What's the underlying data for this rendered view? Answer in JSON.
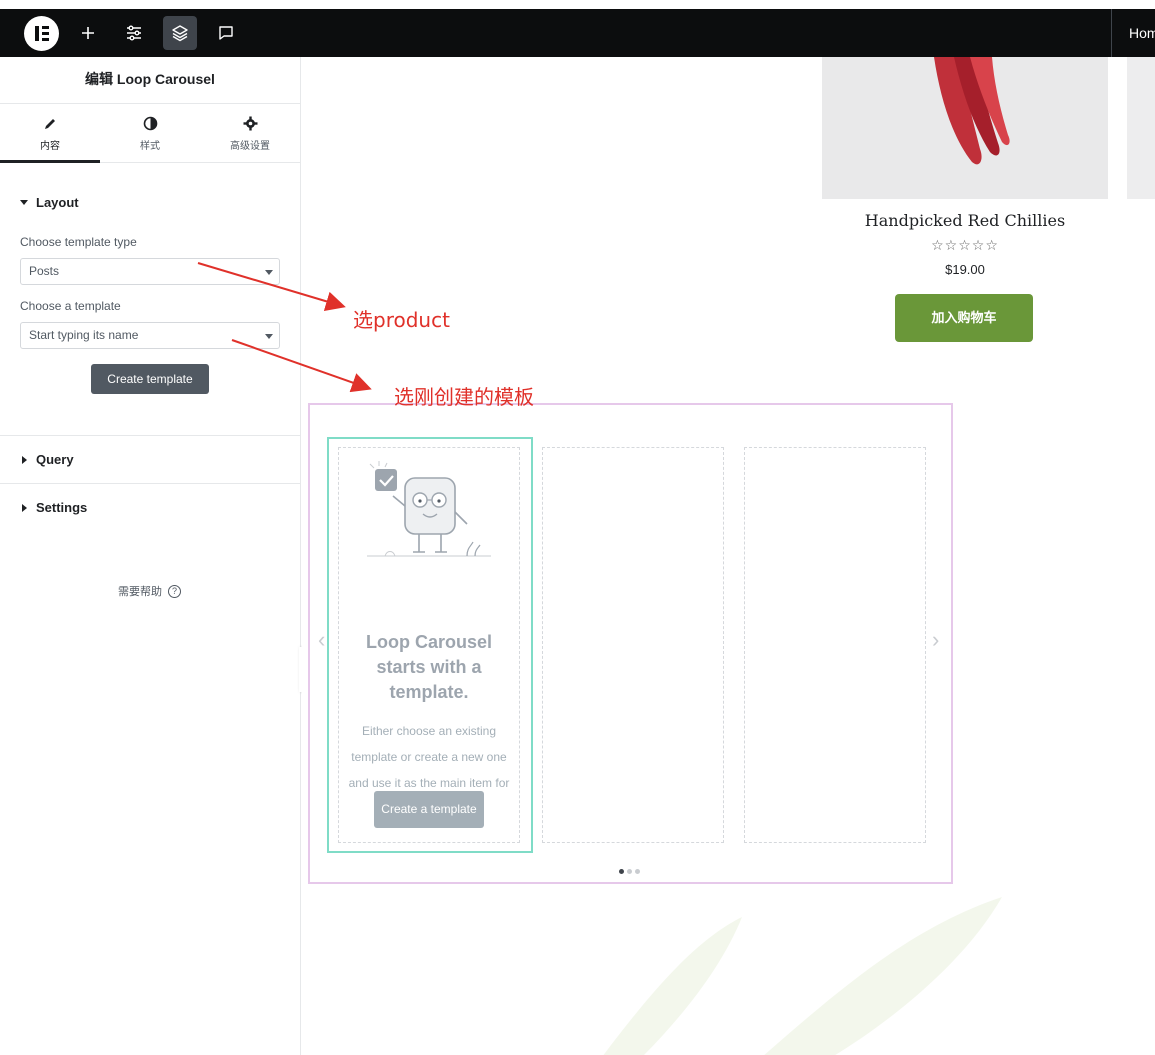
{
  "topbar": {
    "icons": [
      "elementor-logo-icon",
      "plus-icon",
      "sliders-icon",
      "layers-icon",
      "comment-icon"
    ],
    "home_link": "Home"
  },
  "panel": {
    "title": "编辑 Loop Carousel",
    "tabs": [
      {
        "label": "内容",
        "icon": "pencil-icon",
        "active": true
      },
      {
        "label": "样式",
        "icon": "contrast-icon",
        "active": false
      },
      {
        "label": "高级设置",
        "icon": "gear-icon",
        "active": false
      }
    ],
    "layout": {
      "heading": "Layout",
      "template_type_label": "Choose template type",
      "template_type_value": "Posts",
      "template_label": "Choose a template",
      "template_placeholder": "Start typing its name",
      "create_button": "Create template"
    },
    "query_heading": "Query",
    "settings_heading": "Settings",
    "help": "需要帮助"
  },
  "product": {
    "name": "Handpicked Red Chillies",
    "stars": "☆☆☆☆☆",
    "price": "$19.00",
    "cart_button": "加入购物车"
  },
  "carousel": {
    "title": "Loop Carousel starts with a template.",
    "description": "Either choose an existing template or create a new one and use it as the main item for your loop.",
    "button": "Create a template",
    "total_slides": 3,
    "active_dot": 1
  },
  "annotations": {
    "product_note": "选product",
    "template_note": "选刚创建的模板"
  },
  "colors": {
    "topbar": "#0c0d0e",
    "cart": "#6a9739",
    "annotation": "#e0312a",
    "carousel_border": "#e6c8ea",
    "selected_slide": "#7fdcc7"
  }
}
